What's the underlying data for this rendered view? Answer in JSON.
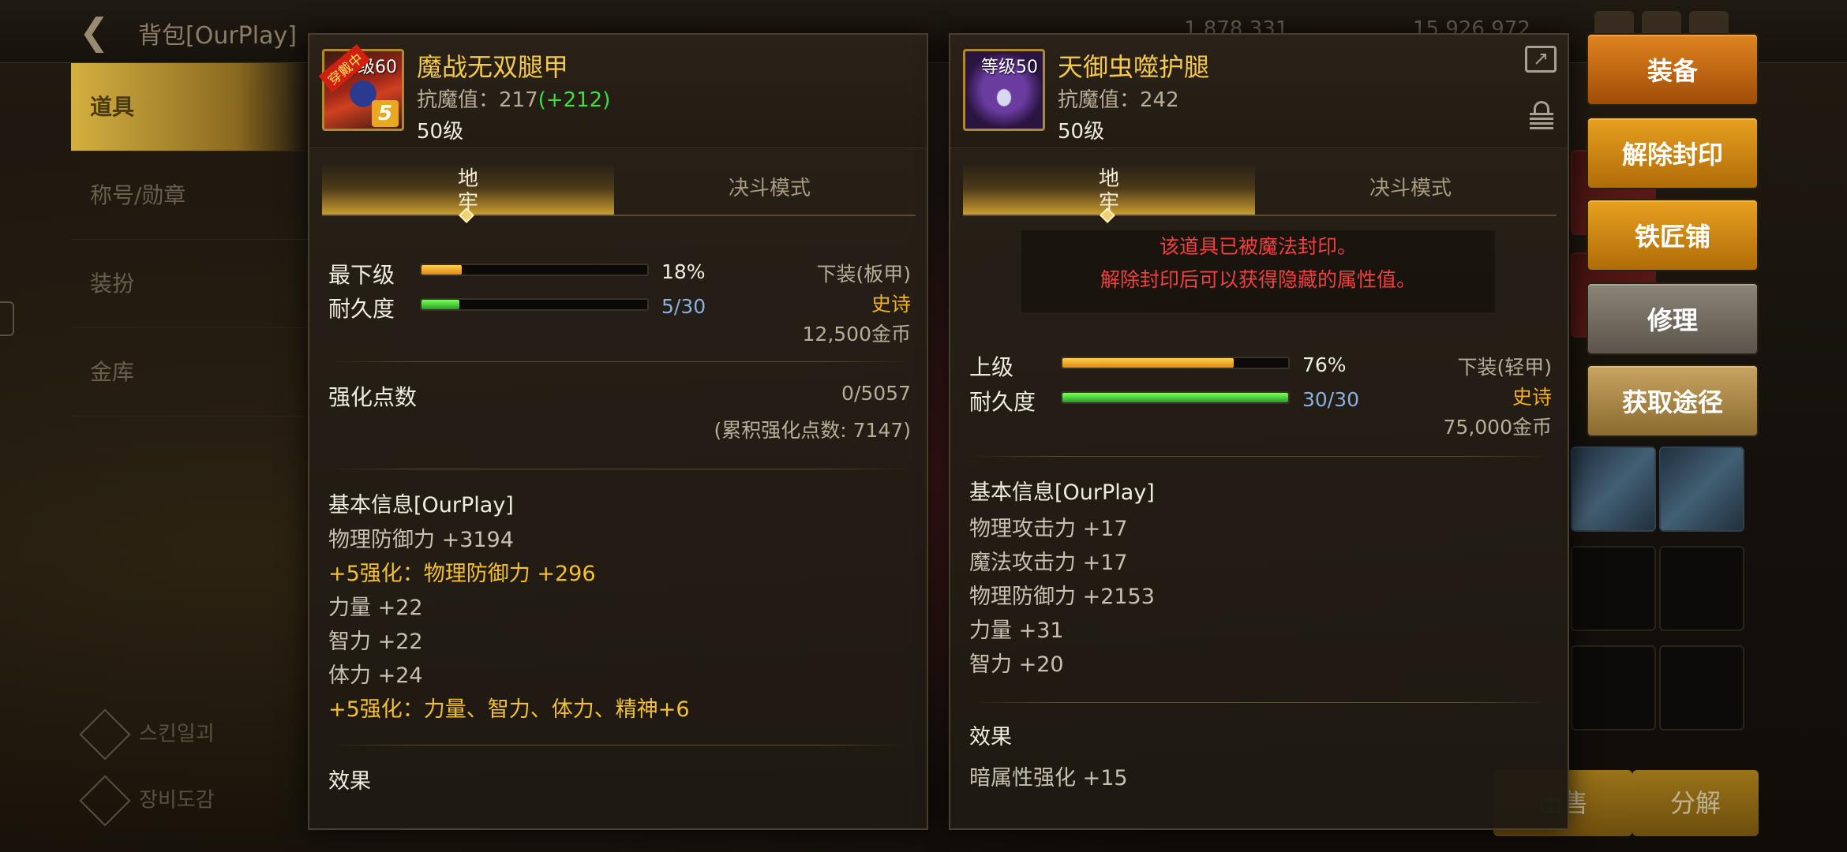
{
  "background": {
    "title": "背包[OurPlay]",
    "currency_a": "1,878,331",
    "currency_b": "15,926,972",
    "sidebar": [
      "道具",
      "称号/勋章",
      "装扮",
      "金库"
    ],
    "sidebar_bottom": [
      "스킨일괴",
      "장비도감"
    ],
    "bottom_buttons": [
      "出售",
      "分解"
    ]
  },
  "left_item": {
    "name": "魔战无双腿甲",
    "level_badge": "等级60",
    "wearing_tag": "穿戴中",
    "enhance_badge": "5",
    "resistance_label": "抗魔值：217",
    "resistance_bonus": "(+212)",
    "level": "50级",
    "tabs": [
      "地牢",
      "决斗模式"
    ],
    "grade_label": "最下级",
    "grade_pct": "18%",
    "grade_value": 0.18,
    "durability_label": "耐久度",
    "durability": "5/30",
    "durability_value": 0.1667,
    "slot_type": "下装(板甲)",
    "rarity": "史诗",
    "price": "12,500金币",
    "enhance_points_label": "强化点数",
    "enhance_points": "0/5057",
    "enhance_points_total": "(累积强化点数: 7147)",
    "basic_info_title": "基本信息[OurPlay]",
    "stats": [
      {
        "text": "物理防御力 +3194",
        "highlight": false
      },
      {
        "text": "+5强化：物理防御力 +296",
        "highlight": true
      },
      {
        "text": "力量 +22",
        "highlight": false
      },
      {
        "text": "智力 +22",
        "highlight": false
      },
      {
        "text": "体力 +24",
        "highlight": false
      },
      {
        "text": "+5强化：力量、智力、体力、精神+6",
        "highlight": true
      }
    ],
    "effect_title": "效果"
  },
  "right_item": {
    "name": "天御虫噬护腿",
    "level_badge": "等级50",
    "resistance_label": "抗魔值：242",
    "level": "50级",
    "tabs": [
      "地牢",
      "决斗模式"
    ],
    "sealed_line1": "该道具已被魔法封印。",
    "sealed_line2": "解除封印后可以获得隐藏的属性值。",
    "grade_label": "上级",
    "grade_pct": "76%",
    "grade_value": 0.76,
    "durability_label": "耐久度",
    "durability": "30/30",
    "durability_value": 1.0,
    "slot_type": "下装(轻甲)",
    "rarity": "史诗",
    "price": "75,000金币",
    "basic_info_title": "基本信息[OurPlay]",
    "stats": [
      {
        "text": "物理攻击力 +17"
      },
      {
        "text": "魔法攻击力 +17"
      },
      {
        "text": "物理防御力 +2153"
      },
      {
        "text": "力量 +31"
      },
      {
        "text": "智力 +20"
      }
    ],
    "effect_title": "效果",
    "effects": [
      "暗属性强化 +15"
    ]
  },
  "actions": {
    "equip": "装备",
    "unseal": "解除封印",
    "blacksmith": "铁匠铺",
    "repair": "修理",
    "obtain": "获取途径"
  },
  "colors": {
    "accent_gold": "#f2c850",
    "epic": "#f2b020",
    "bonus_green": "#3ee040",
    "sealed_red": "#f04040"
  }
}
